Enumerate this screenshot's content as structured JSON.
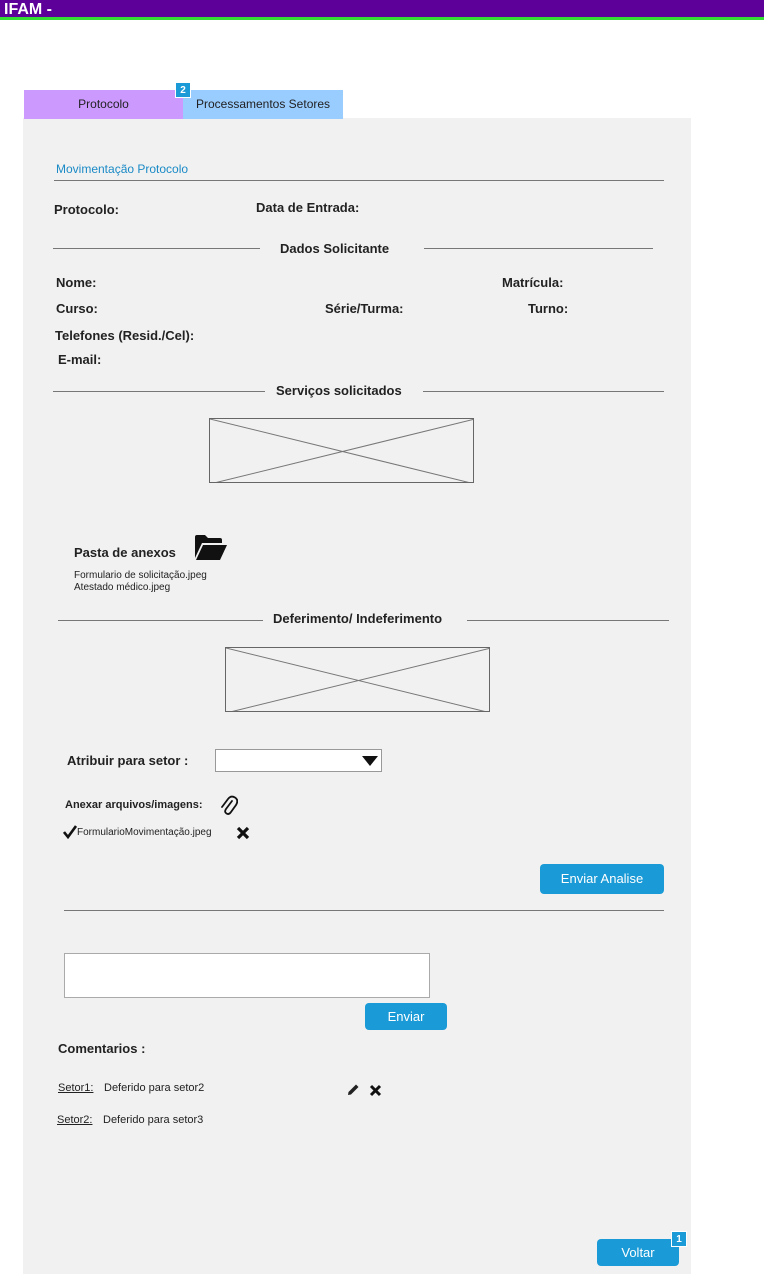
{
  "app": {
    "title": "IFAM -"
  },
  "tabs": [
    {
      "label": "Protocolo"
    },
    {
      "label": "Processamentos Setores",
      "badge": "2"
    }
  ],
  "form": {
    "section_link": "Movimentação  Protocolo",
    "protocolo_label": "Protocolo:",
    "data_entrada_label": "Data de Entrada:",
    "dados_solicitante_title": "Dados Solicitante",
    "nome_label": "Nome:",
    "matricula_label": "Matrícula:",
    "curso_label": "Curso:",
    "serie_label": "Série/Turma:",
    "turno_label": "Turno:",
    "telefones_label": "Telefones (Resid./Cel):",
    "email_label": "E-mail:",
    "servicos_title": "Serviços solicitados",
    "pasta_anexos_label": "Pasta de anexos",
    "anexos": [
      "Formulario de solicitação.jpeg",
      "Atestado médico.jpeg"
    ],
    "deferimento_title": "Deferimento/ Indeferimento",
    "atribuir_label": "Atribuir para setor :",
    "atribuir_value": "",
    "anexar_label": "Anexar arquivos/imagens:",
    "attached_file": "FormularioMovimentação.jpeg",
    "enviar_analise_label": "Enviar Analise",
    "comment_value": "",
    "enviar_label": "Enviar",
    "comentarios_label": "Comentarios :",
    "comments": [
      {
        "author": "Setor1:",
        "text": "Deferido para setor2"
      },
      {
        "author": "Setor2:",
        "text": "Deferido para setor3"
      }
    ],
    "voltar_label": "Voltar",
    "voltar_badge": "1"
  },
  "icons": {
    "folder": "folder-open-icon",
    "paperclip": "paperclip-icon",
    "check": "check-icon",
    "remove": "close-icon",
    "edit": "pencil-icon"
  },
  "colors": {
    "topbar": "#5c0099",
    "topbar_accent": "#33dd33",
    "tab_protocolo": "#cc99ff",
    "tab_processamentos": "#99ccff",
    "button": "#1a9ad6",
    "link": "#1a8ac6",
    "panel": "#f1f1f1"
  }
}
